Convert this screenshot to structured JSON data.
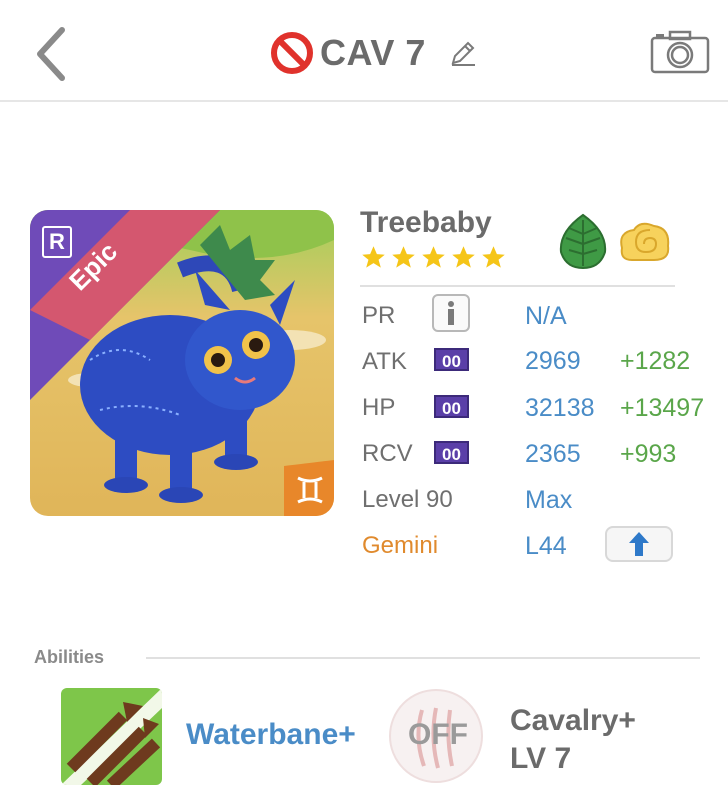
{
  "header": {
    "title": "CAV 7",
    "back_icon": "chevron-left-icon",
    "prohibited_icon": "no-entry-icon",
    "edit_icon": "pencil-icon",
    "camera_icon": "camera-icon"
  },
  "monster": {
    "name": "Treebaby",
    "stars": 5,
    "rarity": "Epic",
    "rarity_badge": "R",
    "element_icons": [
      "leaf-icon",
      "cloud-swirl-icon"
    ],
    "sign_icon": "gemini-icon"
  },
  "stats": {
    "pr": {
      "label": "PR",
      "value": "N/A"
    },
    "atk": {
      "label": "ATK",
      "badge": "00",
      "value": "2969",
      "bonus": "+1282"
    },
    "hp": {
      "label": "HP",
      "badge": "00",
      "value": "32138",
      "bonus": "+13497"
    },
    "rcv": {
      "label": "RCV",
      "badge": "00",
      "value": "2365",
      "bonus": "+993"
    },
    "level": {
      "label": "Level 90",
      "value": "Max"
    },
    "sign": {
      "label": "Gemini",
      "value": "L44"
    }
  },
  "abilities": {
    "title": "Abilities",
    "primary": {
      "name": "Waterbane+"
    },
    "secondary": {
      "status": "OFF",
      "name_line1": "Cavalry+",
      "name_line2": "LV 7"
    }
  },
  "colors": {
    "accent_blue": "#4a8cc7",
    "bonus_green": "#5aa64a",
    "gemini_orange": "#e08a2d",
    "badge_purple": "#5a3fa8",
    "epic_ribbon": "#d9576a"
  }
}
